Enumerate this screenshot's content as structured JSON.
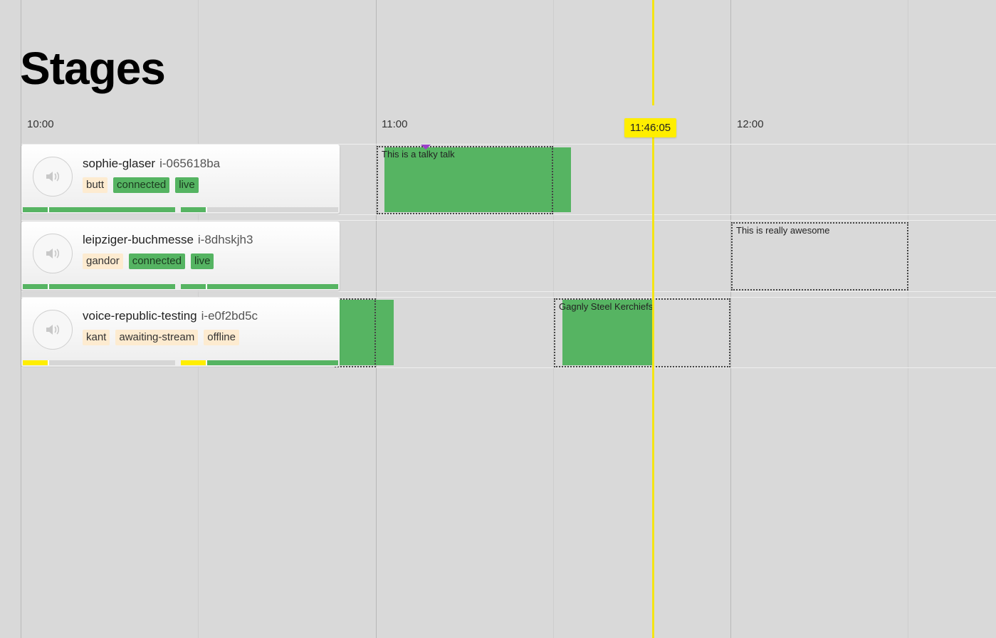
{
  "page": {
    "title": "Stages"
  },
  "timeline": {
    "labels": [
      "10:00",
      "11:00",
      "12:00"
    ],
    "now": "11:46:05",
    "colors": {
      "now": "#ffee00",
      "block": "#56b462"
    }
  },
  "stages": [
    {
      "name": "sophie-glaser",
      "instance": "i-065618ba",
      "tags": [
        {
          "label": "butt",
          "style": "neutral"
        },
        {
          "label": "connected",
          "style": "green"
        },
        {
          "label": "live",
          "style": "green"
        }
      ],
      "talks": [
        {
          "title": "This is a talky talk"
        }
      ]
    },
    {
      "name": "leipziger-buchmesse",
      "instance": "i-8dhskjh3",
      "tags": [
        {
          "label": "gandor",
          "style": "neutral"
        },
        {
          "label": "connected",
          "style": "green"
        },
        {
          "label": "live",
          "style": "green"
        }
      ],
      "talks": [
        {
          "title": "This is really awesome"
        }
      ]
    },
    {
      "name": "voice-republic-testing",
      "instance": "i-e0f2bd5c",
      "tags": [
        {
          "label": "kant",
          "style": "neutral"
        },
        {
          "label": "awaiting-stream",
          "style": "neutral"
        },
        {
          "label": "offline",
          "style": "neutral"
        }
      ],
      "talks": [
        {
          "title": "Gagnly Steel Kerchiefs"
        }
      ]
    }
  ],
  "icons": {
    "speaker": "speaker-volume-icon",
    "marker": "current-position-marker-icon"
  }
}
